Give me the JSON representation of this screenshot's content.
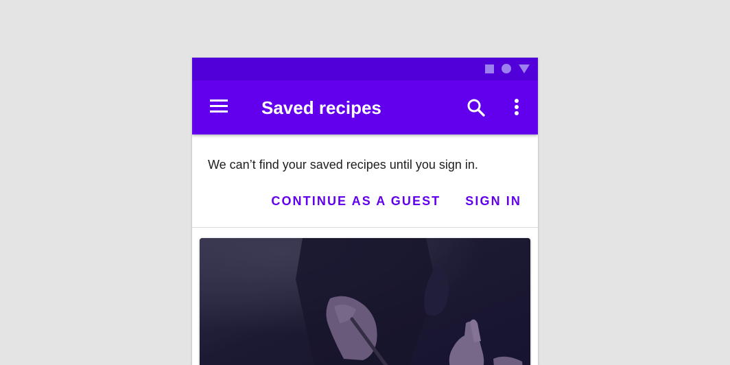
{
  "app_bar": {
    "title": "Saved recipes",
    "menu_icon": "hamburger-menu-icon",
    "search_icon": "search-icon",
    "more_icon": "more-vertical-icon"
  },
  "status_bar": {
    "icons": [
      "square-icon",
      "circle-icon",
      "triangle-icon"
    ]
  },
  "banner": {
    "message": "We can’t find your saved recipes until you sign in.",
    "actions": {
      "guest_label": "CONTINUE AS A GUEST",
      "sign_in_label": "SIGN IN"
    }
  },
  "card": {
    "image": "recipe-photo-hands"
  },
  "colors": {
    "primary": "#6200ee",
    "primary_dark": "#5200d9",
    "status_icon": "#9c80f0",
    "background": "#e4e4e4",
    "surface": "#ffffff",
    "text": "#1d1d1d"
  }
}
